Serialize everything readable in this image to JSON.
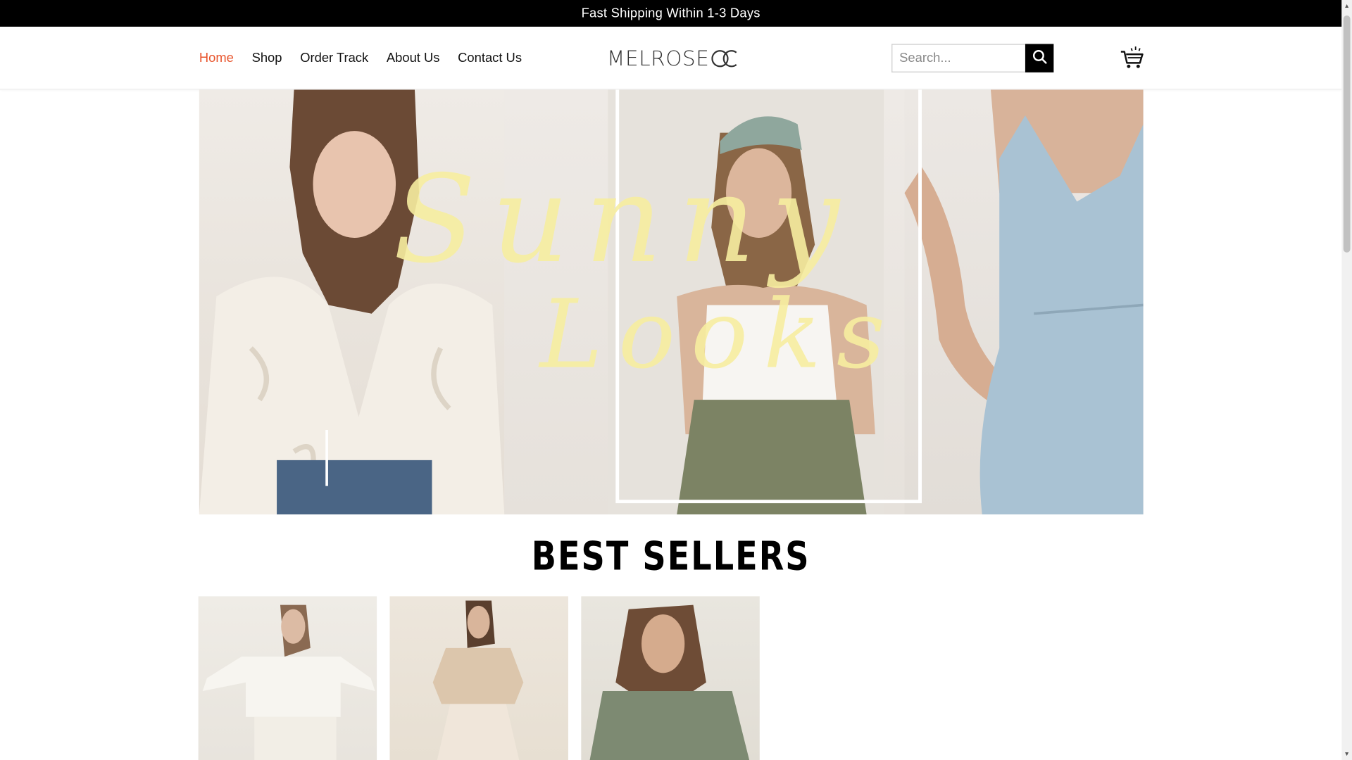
{
  "announcement": {
    "text": "Fast Shipping Within 1-3 Days"
  },
  "nav": {
    "items": [
      {
        "label": "Home",
        "active": true
      },
      {
        "label": "Shop"
      },
      {
        "label": "Order Track"
      },
      {
        "label": "About Us"
      },
      {
        "label": "Contact Us"
      }
    ]
  },
  "brand": {
    "name": "MELROSE",
    "mark": "OC"
  },
  "search": {
    "placeholder": "Search..."
  },
  "hero": {
    "script_line1": "Sunny",
    "script_line2": "Looks"
  },
  "best_sellers": {
    "title": "BEST SELLERS"
  },
  "colors": {
    "accent": "#e8542c",
    "announce_bg": "#000000",
    "script": "#f7eea0"
  },
  "icons": {
    "search": "search-icon",
    "cart": "cart-icon"
  }
}
